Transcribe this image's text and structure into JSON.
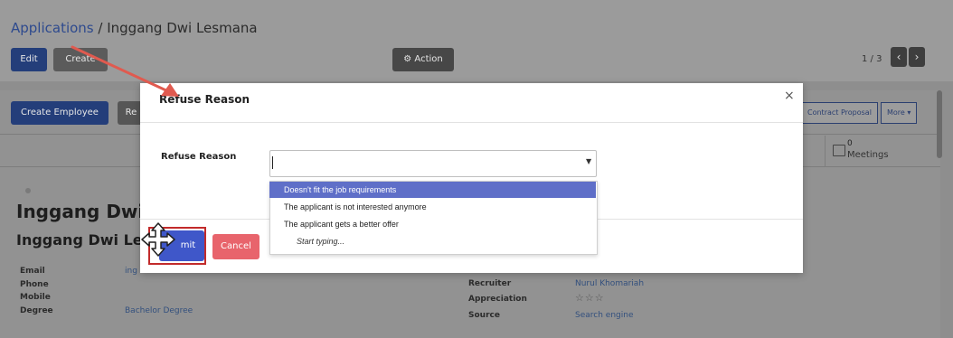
{
  "header": {
    "breadcrumb_link": "Applications",
    "breadcrumb_sep": " / ",
    "breadcrumb_current": "Inggang Dwi Lesmana",
    "edit_label": "Edit",
    "create_label": "Create",
    "action_label": "Action",
    "pager": "1 / 3",
    "prev_glyph": "‹",
    "next_glyph": "›"
  },
  "statusbar": {
    "create_employee": "Create Employee",
    "refuse_partial": "Re",
    "stage_contract": "Contract Proposal",
    "stage_more": "More"
  },
  "smart": {
    "meetings_count": "0",
    "meetings_label": "Meetings"
  },
  "record": {
    "name_partial": "Inggang Dwi L",
    "subtitle_partial": "Inggang Dwi Lesm",
    "labels": {
      "email": "Email",
      "phone": "Phone",
      "mobile": "Mobile",
      "degree": "Degree",
      "recruiter": "Recruiter",
      "appreciation": "Appreciation",
      "source": "Source"
    },
    "email_partial": "ing",
    "degree": "Bachelor Degree",
    "recruiter": "Nurul Khomariah",
    "appreciation": "☆☆☆",
    "source": "Search engine"
  },
  "modal": {
    "title": "Refuse Reason",
    "close": "×",
    "field_label": "Refuse Reason",
    "select_value": "",
    "options": [
      "Doesn't fit the job requirements",
      "The applicant is not interested anymore",
      "The applicant gets a better offer"
    ],
    "highlighted_index": 0,
    "hint": "Start typing...",
    "submit_partial": "mit",
    "cancel_label": "Cancel"
  },
  "colors": {
    "primary": "#3f57c9",
    "danger": "#e8646c",
    "highlight_box": "#c22b2b",
    "annotation_arrow": "#e05a4f"
  },
  "icons": [
    "gear-icon",
    "calendar-icon",
    "close-icon",
    "caret-down-icon",
    "move-cursor-icon",
    "star-icon",
    "chevron-left-icon",
    "chevron-right-icon"
  ]
}
